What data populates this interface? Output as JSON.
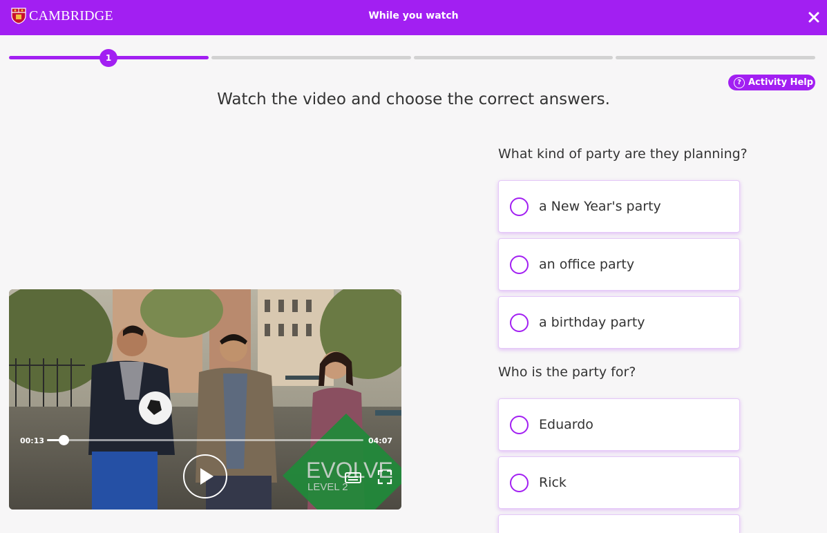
{
  "header": {
    "logo_text": "CAMBRIDGE",
    "title": "While you watch",
    "close_icon": "close-icon"
  },
  "progress": {
    "current_step": "1",
    "total_steps": 4,
    "completed_fraction_of_first_segment": 1.0
  },
  "help": {
    "label": "Activity Help",
    "icon": "question-circle-icon"
  },
  "instruction": "Watch the video and choose the correct answers.",
  "video": {
    "current_time": "00:13",
    "duration": "04:07",
    "progress_fraction": 0.053,
    "watermark_title": "EVOLVE",
    "watermark_level": "LEVEL 2"
  },
  "questions": [
    {
      "text": "What kind of party are they planning?",
      "options": [
        "a New Year's party",
        "an office party",
        "a birthday party"
      ]
    },
    {
      "text": "Who is the party for?",
      "options": [
        "Eduardo",
        "Rick"
      ]
    }
  ],
  "colors": {
    "accent": "#a21ff2",
    "background": "#f7f6f7",
    "text": "#333333",
    "track": "#d2d2d2"
  }
}
